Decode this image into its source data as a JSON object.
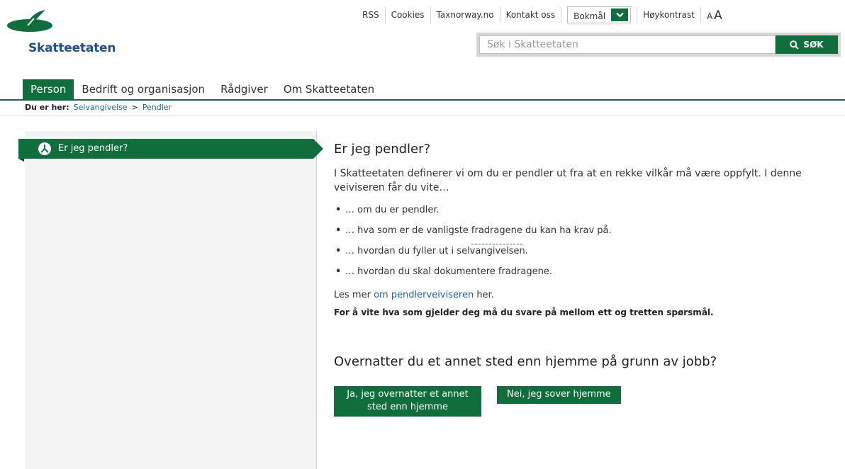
{
  "brand": {
    "name": "Skatteetaten",
    "color": "#0f6e3b",
    "link_color": "#1c63a7",
    "logo_icon": "leaf-logo-icon"
  },
  "top_links": [
    "RSS",
    "Cookies",
    "Taxnorway.no",
    "Kontakt oss"
  ],
  "language": {
    "selected": "Bokmål",
    "icon": "chevron-down-icon"
  },
  "contrast_label": "Høykontrast",
  "text_size": {
    "small": "A",
    "large": "A"
  },
  "search": {
    "placeholder": "Søk i Skatteetaten",
    "button_label": "SØK",
    "icon": "search-icon"
  },
  "nav": {
    "tabs": [
      "Person",
      "Bedrift og organisasjon",
      "Rådgiver",
      "Om Skatteetaten"
    ],
    "active": "Person"
  },
  "breadcrumb": {
    "label": "Du er her:",
    "items": [
      "Selvangivelse",
      "Pendler"
    ],
    "separator": ">"
  },
  "sidebar": {
    "item_label": "Er jeg pendler?",
    "item_icon": "split-path-icon"
  },
  "main": {
    "title": "Er jeg pendler?",
    "intro": "I Skatteetaten definerer vi om du er pendler ut fra at en rekke vilkår må være oppfylt. I denne veiviseren får du vite…",
    "bullets": [
      {
        "pre": "… om du er pendler.",
        "term": "",
        "post": ""
      },
      {
        "pre": "… hva som er de vanligste ",
        "term": "fradragene",
        "post": " du kan ha krav på."
      },
      {
        "pre": "… hvordan du fyller ut i selvangivelsen.",
        "term": "",
        "post": ""
      },
      {
        "pre": "… hvordan du skal dokumentere fradragene.",
        "term": "",
        "post": ""
      }
    ],
    "more": {
      "pre": "Les mer ",
      "link": "om pendlerveiviseren",
      "post": " her."
    },
    "notice": "For å vite hva som gjelder deg må du svare på mellom ett og tretten spørsmål.",
    "question": "Overnatter du et annet sted enn hjemme på grunn av jobb?",
    "answer_yes": "Ja, jeg overnatter et annet sted enn hjemme",
    "answer_no": "Nei, jeg sover hjemme"
  }
}
